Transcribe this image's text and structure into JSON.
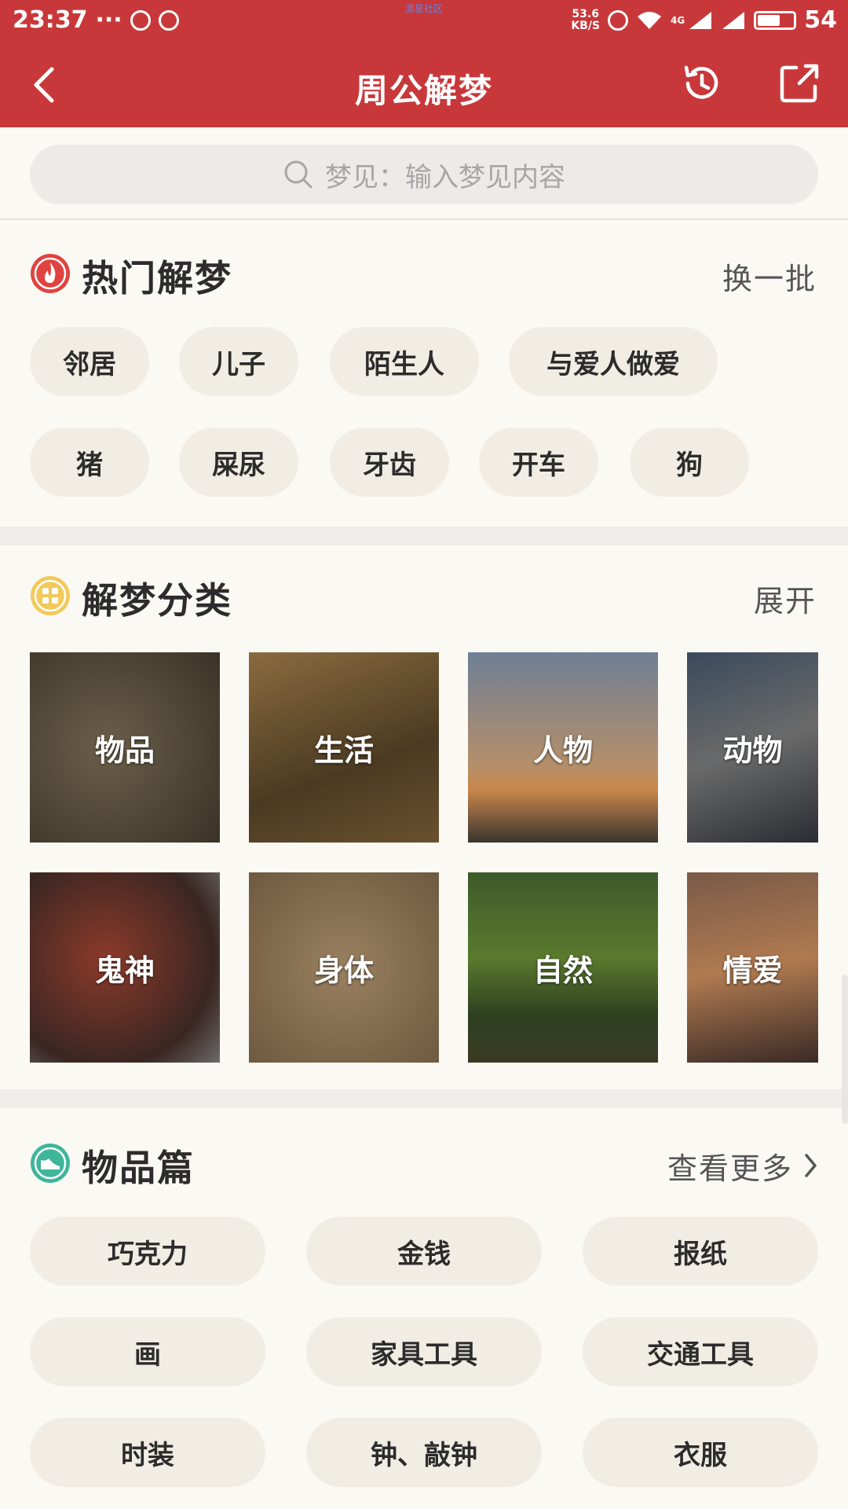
{
  "status_bar": {
    "time": "23:37",
    "dots": "···",
    "center_text": "澳星社区",
    "net_speed_value": "53.6",
    "net_speed_unit": "KB/S",
    "network_label": "4G",
    "battery": "54"
  },
  "header": {
    "title": "周公解梦",
    "icons": [
      "back-icon",
      "history-icon",
      "share-icon"
    ]
  },
  "search": {
    "placeholder": "梦见：输入梦见内容"
  },
  "hot": {
    "title": "热门解梦",
    "action": "换一批",
    "tags": [
      "邻居",
      "儿子",
      "陌生人",
      "与爱人做爱",
      "猪",
      "屎尿",
      "牙齿",
      "开车",
      "狗"
    ]
  },
  "categories": {
    "title": "解梦分类",
    "action": "展开",
    "items": [
      "物品",
      "生活",
      "人物",
      "动物",
      "鬼神",
      "身体",
      "自然",
      "情爱"
    ]
  },
  "items_section": {
    "title": "物品篇",
    "action": "查看更多",
    "tags": [
      "巧克力",
      "金钱",
      "报纸",
      "画",
      "家具工具",
      "交通工具",
      "时装",
      "钟、敲钟",
      "衣服"
    ]
  },
  "colors": {
    "primary": "#C8383A",
    "chip_bg": "#F2EDE4",
    "hot_icon": "#E0433F",
    "category_icon": "#F2C95B",
    "items_icon": "#3FB59A"
  }
}
